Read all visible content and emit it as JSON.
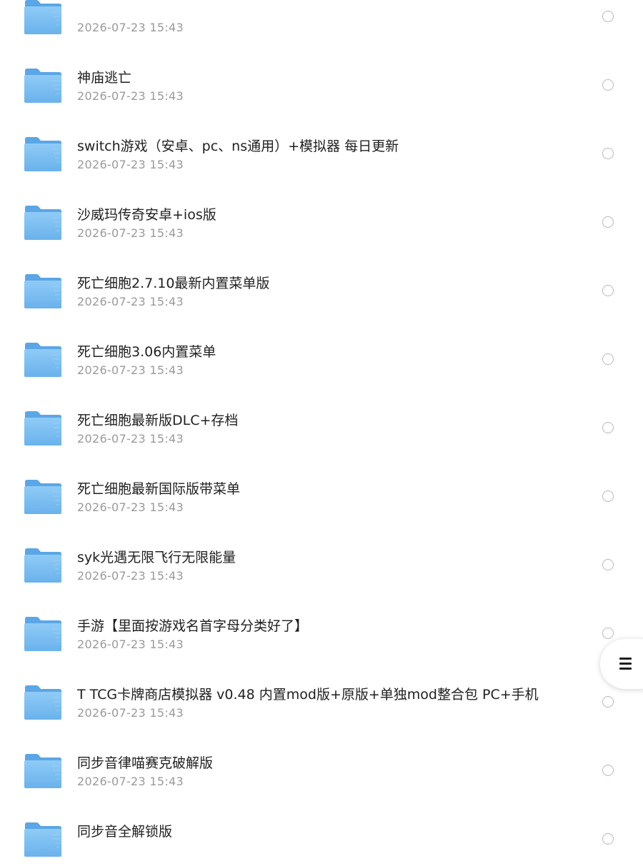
{
  "files": [
    {
      "name": "",
      "date": "2026-07-23 15:43"
    },
    {
      "name": "神庙逃亡",
      "date": "2026-07-23 15:43"
    },
    {
      "name": "switch游戏（安卓、pc、ns通用）+模拟器 每日更新",
      "date": "2026-07-23 15:43"
    },
    {
      "name": "沙威玛传奇安卓+ios版",
      "date": "2026-07-23 15:43"
    },
    {
      "name": "死亡细胞2.7.10最新内置菜单版",
      "date": "2026-07-23 15:43"
    },
    {
      "name": "死亡细胞3.06内置菜单",
      "date": "2026-07-23 15:43"
    },
    {
      "name": "死亡细胞最新版DLC+存档",
      "date": "2026-07-23 15:43"
    },
    {
      "name": "死亡细胞最新国际版带菜单",
      "date": "2026-07-23 15:43"
    },
    {
      "name": "syk光遇无限飞行无限能量",
      "date": "2026-07-23 15:43"
    },
    {
      "name": "手游【里面按游戏名首字母分类好了】",
      "date": "2026-07-23 15:43"
    },
    {
      "name": "T TCG卡牌商店模拟器 v0.48 内置mod版+原版+单独mod整合包 PC+手机",
      "date": "2026-07-23 15:43"
    },
    {
      "name": "同步音律喵赛克破解版",
      "date": "2026-07-23 15:43"
    },
    {
      "name": "同步音全解锁版",
      "date": ""
    }
  ],
  "icons": {
    "folder": "folder-icon",
    "select": "radio-circle-icon",
    "menu": "menu-lines-icon"
  },
  "colors": {
    "folder_front": "#7cc0f2",
    "folder_back": "#5aa6e6",
    "title": "#1f1f1f",
    "date": "#9a9a9a",
    "radio_border": "#b9b9b9"
  }
}
